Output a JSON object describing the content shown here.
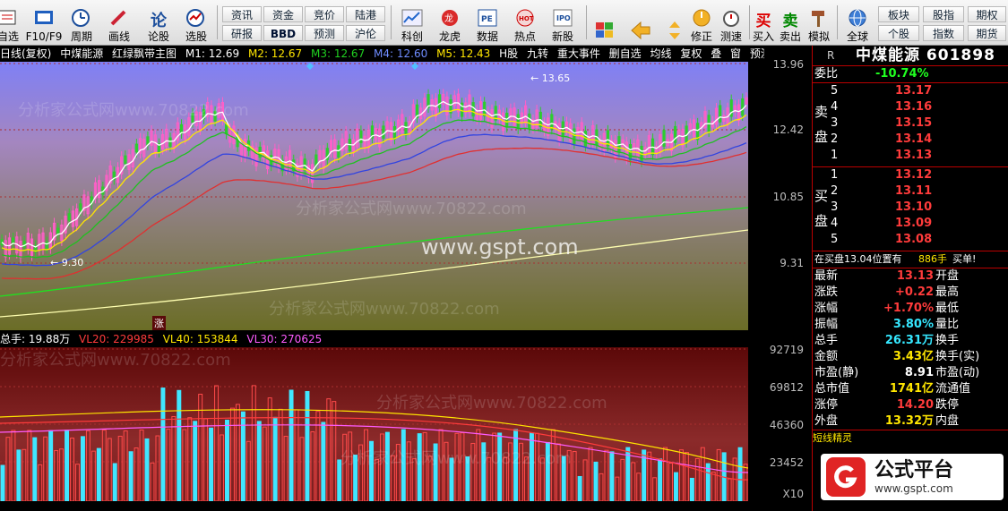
{
  "toolbar": {
    "items": [
      {
        "label": "自选"
      },
      {
        "label": "F10/F9"
      },
      {
        "label": "周期"
      },
      {
        "label": "画线"
      },
      {
        "label": "论股"
      },
      {
        "label": "选股"
      },
      {
        "label": "科创"
      },
      {
        "label": "龙虎"
      },
      {
        "label": "数据"
      },
      {
        "label": "热点"
      },
      {
        "label": "新股"
      },
      {
        "label": "修正"
      },
      {
        "label": "测速"
      },
      {
        "label": "买入"
      },
      {
        "label": "卖出"
      },
      {
        "label": "模拟"
      },
      {
        "label": "全球"
      }
    ],
    "small_buttons": [
      {
        "label": "资讯"
      },
      {
        "label": "资金"
      },
      {
        "label": "竞价"
      },
      {
        "label": "陆港"
      },
      {
        "label": "研报"
      },
      {
        "label": "BBD"
      },
      {
        "label": "预测"
      },
      {
        "label": "沪伦"
      },
      {
        "label": "板块"
      },
      {
        "label": "股指"
      },
      {
        "label": "期权"
      },
      {
        "label": "个股"
      },
      {
        "label": "指数"
      },
      {
        "label": "期货"
      }
    ]
  },
  "chart_title": {
    "period": "日线(复权)",
    "stock": "中煤能源",
    "indicator": "红绿飘带主图",
    "ma": [
      {
        "name": "M1",
        "value": "12.69"
      },
      {
        "name": "M2",
        "value": "12.67"
      },
      {
        "name": "M3",
        "value": "12.67"
      },
      {
        "name": "M4",
        "value": "12.60"
      },
      {
        "name": "M5",
        "value": "12.43"
      }
    ],
    "tabs": [
      "H股",
      "九转",
      "重大事件",
      "删自选",
      "均线",
      "复权",
      "叠",
      "窗",
      "预测"
    ]
  },
  "price_axis": [
    "13.96",
    "12.42",
    "10.85",
    "9.31"
  ],
  "chart_notes": {
    "high": "13.65",
    "low": "9.30",
    "marker": "涨"
  },
  "volume_header": {
    "total": "总手: 19.88万",
    "vl20": "VL20: 229985",
    "vl40": "VL40: 153844",
    "vl30": "VL30: 270625"
  },
  "volume_axis": [
    "92719",
    "69812",
    "46360",
    "23452",
    "X10"
  ],
  "watermark": {
    "site": "www.gspt.com",
    "text": "分析家公式网www.70822.com"
  },
  "quote": {
    "code_tag": "R",
    "name": "中煤能源",
    "code": "601898",
    "weibi_label": "委比",
    "weibi": "-10.74%",
    "sell_label": "卖盘",
    "sell": [
      {
        "lvl": "5",
        "price": "13.17"
      },
      {
        "lvl": "4",
        "price": "13.16"
      },
      {
        "lvl": "3",
        "price": "13.15"
      },
      {
        "lvl": "2",
        "price": "13.14"
      },
      {
        "lvl": "1",
        "price": "13.13"
      }
    ],
    "buy_label": "买盘",
    "buy": [
      {
        "lvl": "1",
        "price": "13.12"
      },
      {
        "lvl": "2",
        "price": "13.11"
      },
      {
        "lvl": "3",
        "price": "13.10"
      },
      {
        "lvl": "4",
        "price": "13.09"
      },
      {
        "lvl": "5",
        "price": "13.08"
      }
    ],
    "notice": "在买盘13.04位置有",
    "notice_qty": "886手",
    "notice_tail": "买单!",
    "stats": [
      {
        "label": "最新",
        "value": "13.13",
        "label2": "开盘"
      },
      {
        "label": "涨跌",
        "value": "+0.22",
        "label2": "最高"
      },
      {
        "label": "涨幅",
        "value": "+1.70%",
        "label2": "最低"
      },
      {
        "label": "振幅",
        "value": "3.80%",
        "label2": "量比"
      },
      {
        "label": "总手",
        "value": "26.31万",
        "label2": "换手"
      },
      {
        "label": "金额",
        "value": "3.43亿",
        "label2": "换手(实)"
      },
      {
        "label": "市盈(静)",
        "value": "8.91",
        "label2": "市盈(动)"
      },
      {
        "label": "总市值",
        "value": "1741亿",
        "label2": "流通值"
      },
      {
        "label": "涨停",
        "value": "14.20",
        "label2": "跌停"
      },
      {
        "label": "外盘",
        "value": "13.32万",
        "label2": "内盘"
      }
    ],
    "section": "短线精灵"
  },
  "badge": {
    "title": "公式平台",
    "url": "www.gspt.com"
  },
  "colors": {
    "red": "#ff3b3b",
    "green": "#20ff20",
    "cyan": "#35e7ff",
    "yellow": "#ffe600"
  }
}
